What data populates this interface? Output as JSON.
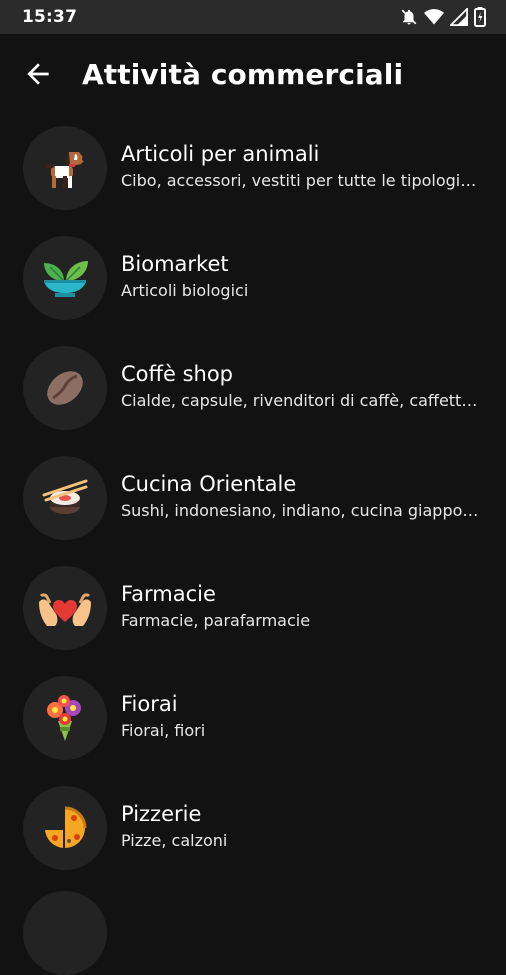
{
  "status": {
    "time": "15:37",
    "icons": [
      "bell-off-icon",
      "wifi-icon",
      "signal-icon",
      "battery-icon"
    ]
  },
  "header": {
    "title": "Attività commerciali",
    "back_icon": "arrow-back-icon"
  },
  "categories": [
    {
      "title": "Articoli per animali",
      "subtitle": "Cibo, accessori, vestiti per tutte le tipologie di animali",
      "icon": "dog-icon"
    },
    {
      "title": "Biomarket",
      "subtitle": "Articoli biologici",
      "icon": "plant-bowl-icon"
    },
    {
      "title": "Coffè shop",
      "subtitle": "Cialde, capsule, rivenditori di caffè, caffetterie",
      "icon": "coffee-bean-icon"
    },
    {
      "title": "Cucina Orientale",
      "subtitle": "Sushi, indonesiano, indiano, cucina giapponese",
      "icon": "sushi-icon"
    },
    {
      "title": "Farmacie",
      "subtitle": "Farmacie, parafarmacie",
      "icon": "hands-heart-icon"
    },
    {
      "title": "Fiorai",
      "subtitle": "Fiorai, fiori",
      "icon": "flower-bouquet-icon"
    },
    {
      "title": "Pizzerie",
      "subtitle": "Pizze, calzoni",
      "icon": "pizza-icon"
    }
  ],
  "colors": {
    "background": "#121212",
    "status_bar": "#2b2b2b",
    "avatar_bg": "#232323"
  }
}
